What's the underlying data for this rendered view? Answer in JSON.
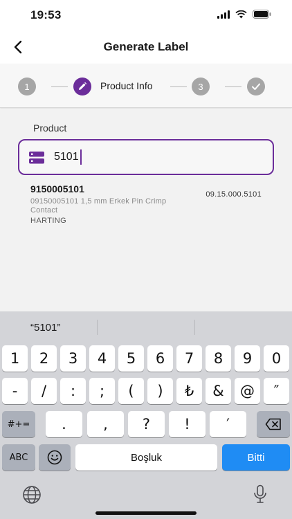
{
  "status_bar": {
    "time": "19:53"
  },
  "header": {
    "title": "Generate Label"
  },
  "stepper": {
    "steps": [
      {
        "label": "1"
      },
      {
        "label": "Product Info"
      },
      {
        "label": "3"
      }
    ]
  },
  "form": {
    "field_label": "Product",
    "search_value": "5101"
  },
  "result": {
    "code": "9150005101",
    "description": "09150005101 1,5 mm Erkek Pin Crimp Contact",
    "brand": "HARTING",
    "reference": "09.15.000.5101"
  },
  "keyboard": {
    "suggestion": "“5101”",
    "row1": [
      "1",
      "2",
      "3",
      "4",
      "5",
      "6",
      "7",
      "8",
      "9",
      "0"
    ],
    "row2": [
      "-",
      "/",
      ":",
      ";",
      "(",
      ")",
      "₺",
      "&",
      "@",
      "″"
    ],
    "row3": [
      ".",
      ",",
      "?",
      "!",
      "′"
    ],
    "symbols_key": "#+=",
    "abc_key": "ABC",
    "space_key": "Boşluk",
    "done_key": "Bitti"
  },
  "colors": {
    "accent": "#6b2d9a",
    "done_button": "#1f8cf4"
  }
}
